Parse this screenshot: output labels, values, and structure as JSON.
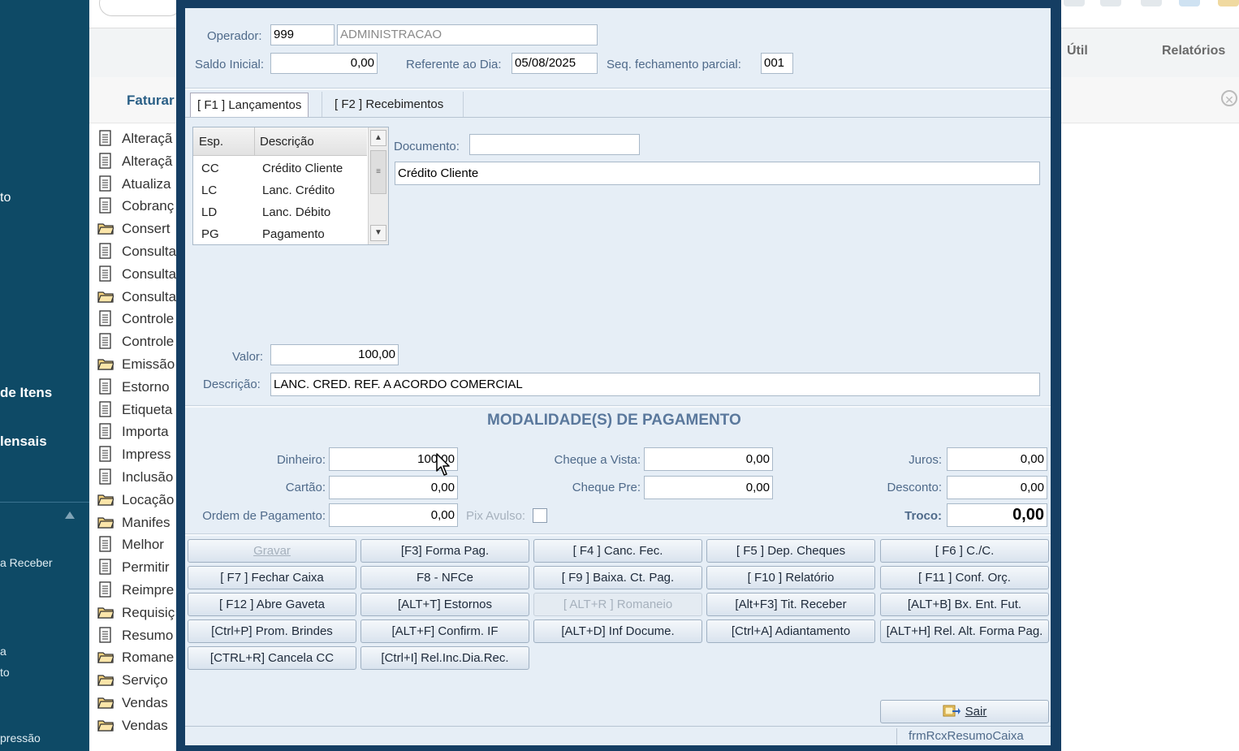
{
  "background": {
    "sidebar_labels": [
      "to",
      "de Itens",
      "lensais",
      "a Receber",
      "a",
      "to",
      "pressão"
    ],
    "menu": {
      "util": "Útil",
      "relatorios": "Relatórios"
    },
    "subbar_title": "Faturar",
    "list_items": [
      {
        "label": "Alteraçã",
        "kind": "doc"
      },
      {
        "label": "Alteraçã",
        "kind": "doc"
      },
      {
        "label": "Atualiza",
        "kind": "doc"
      },
      {
        "label": "Cobranç",
        "kind": "doc"
      },
      {
        "label": "Consert",
        "kind": "folder"
      },
      {
        "label": "Consulta",
        "kind": "doc"
      },
      {
        "label": "Consulta",
        "kind": "doc"
      },
      {
        "label": "Consulta",
        "kind": "folder"
      },
      {
        "label": "Controle",
        "kind": "doc"
      },
      {
        "label": "Controle",
        "kind": "doc"
      },
      {
        "label": "Emissão",
        "kind": "folder"
      },
      {
        "label": "Estorno",
        "kind": "doc"
      },
      {
        "label": "Etiqueta",
        "kind": "doc"
      },
      {
        "label": "Importa",
        "kind": "doc"
      },
      {
        "label": "Impress",
        "kind": "doc"
      },
      {
        "label": "Inclusão",
        "kind": "doc"
      },
      {
        "label": "Locação",
        "kind": "folder"
      },
      {
        "label": "Manifes",
        "kind": "folder"
      },
      {
        "label": "Melhor",
        "kind": "doc"
      },
      {
        "label": "Permitir",
        "kind": "doc"
      },
      {
        "label": "Reimpre",
        "kind": "doc"
      },
      {
        "label": "Requisiç",
        "kind": "folder"
      },
      {
        "label": "Resumo",
        "kind": "doc"
      },
      {
        "label": "Romane",
        "kind": "folder"
      },
      {
        "label": "Serviço",
        "kind": "folder"
      },
      {
        "label": "Vendas",
        "kind": "folder"
      },
      {
        "label": "Vendas",
        "kind": "folder"
      }
    ]
  },
  "window": {
    "operador_label": "Operador:",
    "operador_code": "999",
    "operador_name": "ADMINISTRACAO",
    "saldo_label": "Saldo Inicial:",
    "saldo_value": "0,00",
    "referente_label": "Referente ao Dia:",
    "referente_value": "05/08/2025",
    "seq_label": "Seq. fechamento parcial:",
    "seq_value": "001",
    "tabs": [
      "[ F1 ] Lançamentos",
      "[ F2 ] Recebimentos"
    ],
    "grid": {
      "headers": [
        "Esp.",
        "Descrição"
      ],
      "rows": [
        {
          "esp": "CC",
          "desc": "Crédito Cliente"
        },
        {
          "esp": "LC",
          "desc": "Lanc. Crédito"
        },
        {
          "esp": "LD",
          "desc": "Lanc. Débito"
        },
        {
          "esp": "PG",
          "desc": "Pagamento"
        }
      ]
    },
    "documento_label": "Documento:",
    "documento_value": "",
    "tipo_value": "Crédito Cliente",
    "valor_label": "Valor:",
    "valor_value": "100,00",
    "descricao_label": "Descrição:",
    "descricao_value": "LANC. CRED. REF. A ACORDO COMERCIAL",
    "modalidades_title": "MODALIDADE(S)  DE PAGAMENTO",
    "dinheiro_label": "Dinheiro:",
    "dinheiro_value": "100,00",
    "cartao_label": "Cartão:",
    "cartao_value": "0,00",
    "ordem_label": "Ordem de Pagamento:",
    "ordem_value": "0,00",
    "pix_label": "Pix Avulso:",
    "cheque_vista_label": "Cheque a Vista:",
    "cheque_vista_value": "0,00",
    "cheque_pre_label": "Cheque Pre:",
    "cheque_pre_value": "0,00",
    "juros_label": "Juros:",
    "juros_value": "0,00",
    "desconto_label": "Desconto:",
    "desconto_value": "0,00",
    "troco_label": "Troco:",
    "troco_value": "0,00",
    "buttons": [
      {
        "label": "Gravar",
        "enabled": false
      },
      {
        "label": "[F3] Forma Pag.",
        "enabled": true
      },
      {
        "label": "[ F4 ] Canc. Fec.",
        "enabled": true
      },
      {
        "label": "[ F5 ] Dep. Cheques",
        "enabled": true
      },
      {
        "label": "[ F6 ] C./C.",
        "enabled": true
      },
      {
        "label": "[ F7 ] Fechar Caixa",
        "enabled": true
      },
      {
        "label": "F8 - NFCe",
        "enabled": true
      },
      {
        "label": "[ F9 ] Baixa. Ct. Pag.",
        "enabled": true
      },
      {
        "label": "[ F10 ] Relatório",
        "enabled": true
      },
      {
        "label": "[ F11 ] Conf. Orç.",
        "enabled": true
      },
      {
        "label": "[ F12 ] Abre Gaveta",
        "enabled": true
      },
      {
        "label": "[ALT+T] Estornos",
        "enabled": true
      },
      {
        "label": "[ ALT+R ] Romaneio",
        "enabled": false
      },
      {
        "label": "[Alt+F3] Tit. Receber",
        "enabled": true
      },
      {
        "label": "[ALT+B] Bx. Ent. Fut.",
        "enabled": true
      },
      {
        "label": "[Ctrl+P] Prom. Brindes",
        "enabled": true
      },
      {
        "label": "[ALT+F] Confirm. IF",
        "enabled": true
      },
      {
        "label": "[ALT+D] Inf Docume.",
        "enabled": true
      },
      {
        "label": "[Ctrl+A] Adiantamento",
        "enabled": true
      },
      {
        "label": "[ALT+H] Rel. Alt. Forma Pag.",
        "enabled": true
      },
      {
        "label": "[CTRL+R] Cancela CC",
        "enabled": true
      },
      {
        "label": "[Ctrl+I] Rel.Inc.Dia.Rec.",
        "enabled": true
      }
    ],
    "sair_label": "Sair",
    "status_form": "frmRcxResumoCaixa"
  }
}
